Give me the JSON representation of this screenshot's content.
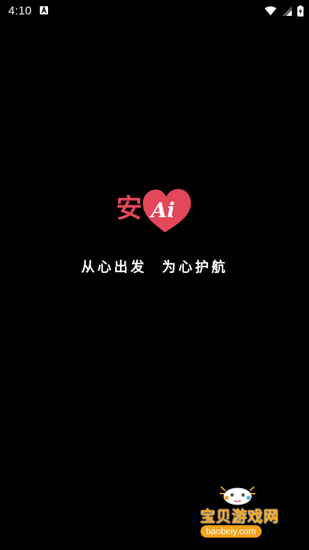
{
  "status_bar": {
    "time": "4:10",
    "notification_icon": "android-a-icon",
    "wifi_icon": "wifi-icon",
    "signal_icon": "cell-signal-icon",
    "battery_icon": "battery-charging-icon"
  },
  "splash": {
    "logo": {
      "char": "安",
      "text": "Ai",
      "heart_color": "#e2475a"
    },
    "slogan": "从心出发  为心护航"
  },
  "watermark": {
    "title": "宝贝游戏网",
    "url": "baobeiy.com",
    "accent_color": "#f3a31b"
  }
}
